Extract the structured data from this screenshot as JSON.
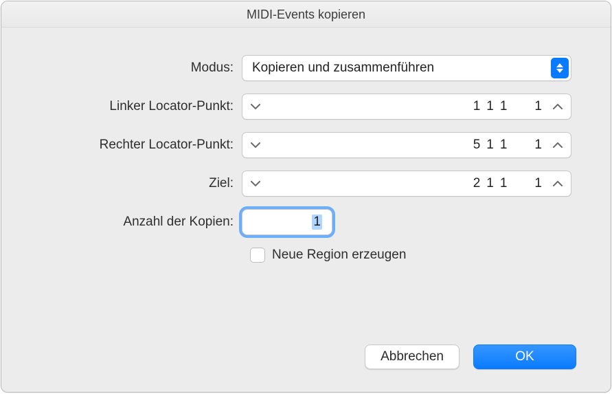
{
  "header": {
    "title": "MIDI-Events kopieren"
  },
  "labels": {
    "modus": "Modus:",
    "left_locator": "Linker Locator-Punkt:",
    "right_locator": "Rechter Locator-Punkt:",
    "ziel": "Ziel:",
    "copies": "Anzahl der Kopien:"
  },
  "mode": {
    "value": "Kopieren und zusammenführen"
  },
  "left_locator": {
    "v1": "1",
    "v2": "1",
    "v3": "1",
    "v4": "1"
  },
  "right_locator": {
    "v1": "5",
    "v2": "1",
    "v3": "1",
    "v4": "1"
  },
  "ziel": {
    "v1": "2",
    "v2": "1",
    "v3": "1",
    "v4": "1"
  },
  "copies": {
    "value": "1"
  },
  "new_region": {
    "label": "Neue Region erzeugen",
    "checked": false
  },
  "buttons": {
    "cancel": "Abbrechen",
    "ok": "OK"
  }
}
